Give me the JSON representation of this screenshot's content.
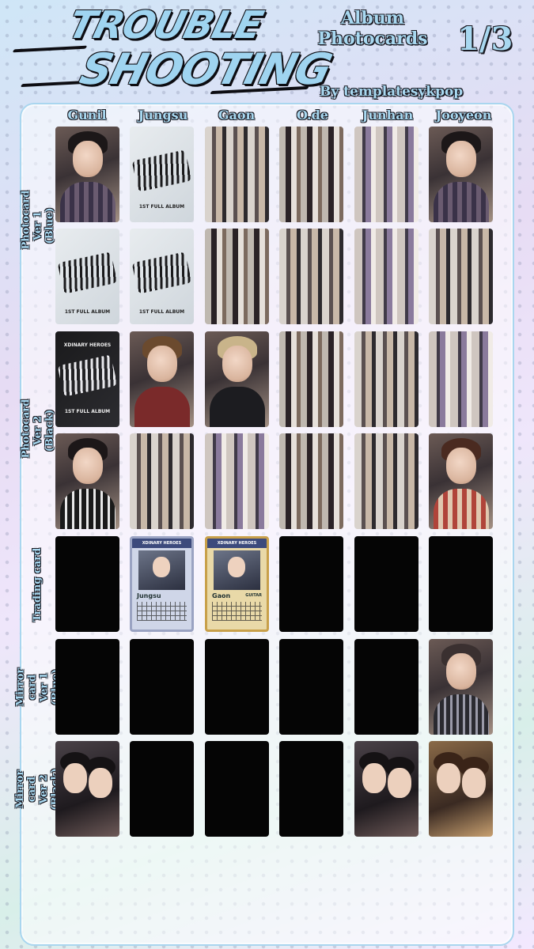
{
  "header": {
    "title_line1": "TROUBLE",
    "title_line2": "SHOOTING",
    "album_label": "Album Photocards",
    "page": "1/3",
    "credit": "By templatesykpop"
  },
  "members": [
    "Gunil",
    "Jungsu",
    "Gaon",
    "O.de",
    "Junhan",
    "Jooyeon"
  ],
  "rows": [
    {
      "label": "Photocard Ver 1 (Blue)"
    },
    {
      "label": "Photocard Ver 2 (Black)"
    },
    {
      "label": "Trading card"
    },
    {
      "label": "Mirror card Ver 1 (Blue)"
    },
    {
      "label": "Mirror card Ver 2 (Black)"
    }
  ],
  "album_card": {
    "brand": "XDINARY HEROES",
    "edition": "1ST FULL ALBUM"
  },
  "trading_cards": {
    "jungsu": {
      "brand": "XDINARY HEROES",
      "name": "Jungsu",
      "role": ""
    },
    "gaon": {
      "brand": "XDINARY HEROES",
      "name": "Gaon",
      "role": "GUITAR"
    }
  },
  "theme": {
    "label_color": "#a8d8f0",
    "outline_color": "#1a1a22",
    "panel_border": "#a9d6ef",
    "empty_card": "#050505"
  }
}
